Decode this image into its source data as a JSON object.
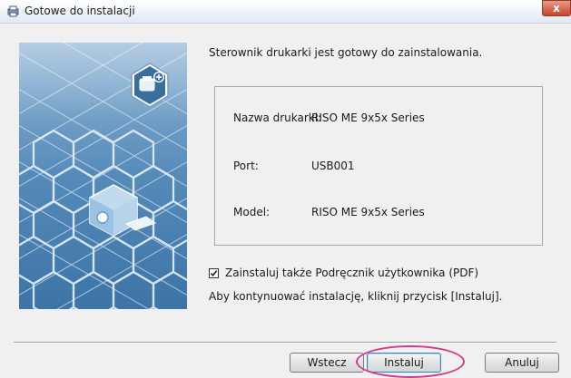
{
  "window": {
    "title": "Gotowe do instalacji",
    "close_label": "x"
  },
  "main": {
    "intro_text": "Sterownik drukarki jest gotowy do zainstalowania.",
    "info": {
      "printer_name_label": "Nazwa drukarki:",
      "printer_name_value": "RISO ME 9x5x Series",
      "port_label": "Port:",
      "port_value": "USB001",
      "model_label": "Model:",
      "model_value": "RISO ME 9x5x Series"
    },
    "checkbox": {
      "label": "Zainstaluj także Podręcznik użytkownika (PDF)",
      "checked": true
    },
    "hint_text": "Aby kontynuować instalację, kliknij przycisk [Instaluj]."
  },
  "buttons": {
    "back_label": "Wstecz",
    "install_label": "Instaluj",
    "cancel_label": "Anuluj"
  },
  "colors": {
    "side_image_bg": "#5389b7",
    "highlight": "#d43a8a",
    "close_button": "#c9442b"
  },
  "icons": {
    "title": "printer-setup-icon",
    "badge": "add-printer-icon"
  }
}
